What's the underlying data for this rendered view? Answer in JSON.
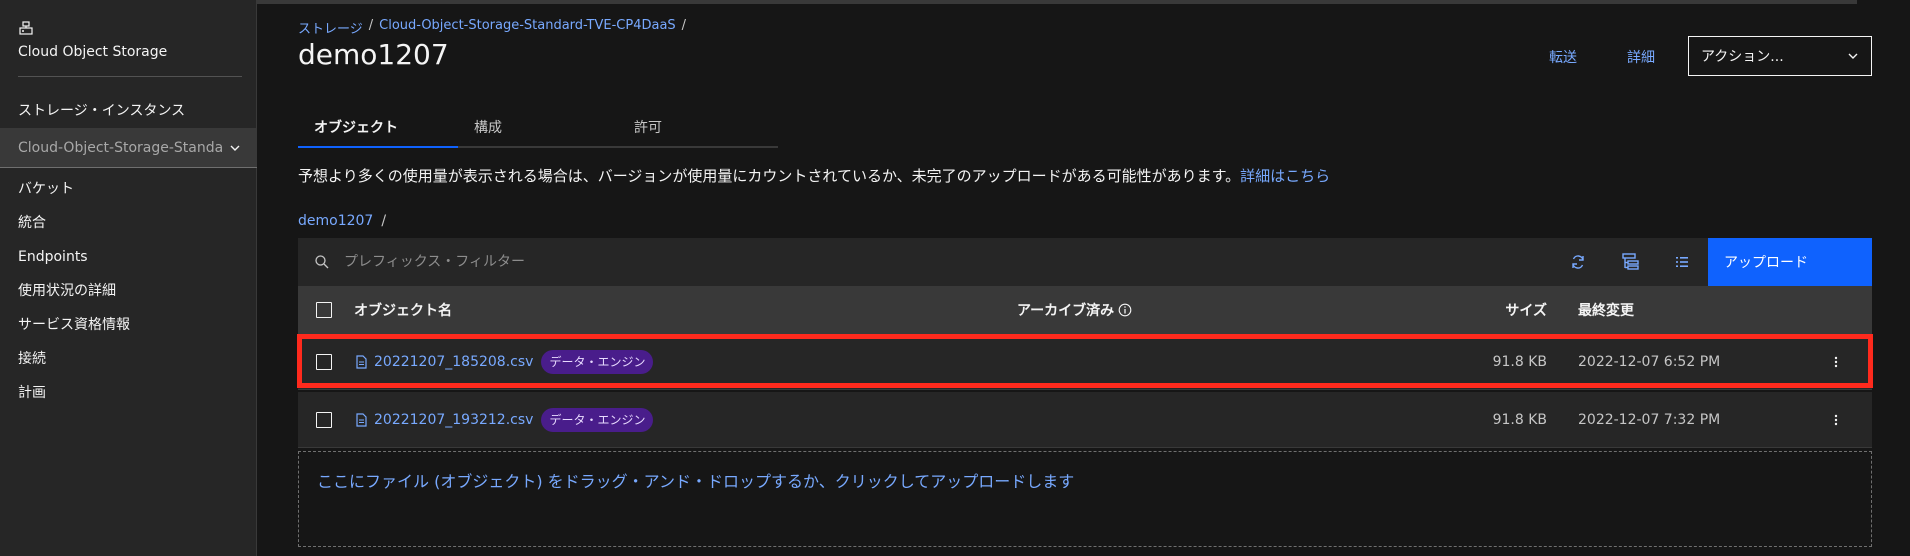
{
  "sidebar": {
    "service_name": "Cloud Object Storage",
    "instances_label": "ストレージ・インスタンス",
    "selected_instance": "Cloud-Object-Storage-Standa",
    "nav": [
      "バケット",
      "統合",
      "Endpoints",
      "使用状況の詳細",
      "サービス資格情報",
      "接続",
      "計画"
    ]
  },
  "breadcrumb": {
    "storage": "ストレージ",
    "instance": "Cloud-Object-Storage-Standard-TVE-CP4DaaS",
    "sep": "/"
  },
  "header": {
    "title": "demo1207",
    "transfer": "転送",
    "details": "詳細",
    "actions": "アクション..."
  },
  "tabs": [
    "オブジェクト",
    "構成",
    "許可"
  ],
  "notice": {
    "text": "予想より多くの使用量が表示される場合は、バージョンが使用量にカウントされているか、未完了のアップロードがある可能性があります。",
    "link": "詳細はこちら"
  },
  "path": {
    "bucket": "demo1207",
    "sep": "/"
  },
  "search": {
    "placeholder": "プレフィックス・フィルター",
    "upload_label": "アップロード"
  },
  "table": {
    "headers": {
      "name": "オブジェクト名",
      "archived": "アーカイブ済み",
      "size": "サイズ",
      "modified": "最終変更"
    },
    "rows": [
      {
        "name": "20221207_185208.csv",
        "tag": "データ・エンジン",
        "size": "91.8 KB",
        "modified": "2022-12-07 6:52 PM"
      },
      {
        "name": "20221207_193212.csv",
        "tag": "データ・エンジン",
        "size": "91.8 KB",
        "modified": "2022-12-07 7:32 PM"
      }
    ]
  },
  "dropzone": "ここにファイル (オブジェクト) をドラッグ・アンド・ドロップするか、クリックしてアップロードします",
  "colors": {
    "accent": "#0f62fe",
    "link": "#78a9ff",
    "highlight": "#ff2a1d",
    "tag_bg": "#491d8b"
  }
}
